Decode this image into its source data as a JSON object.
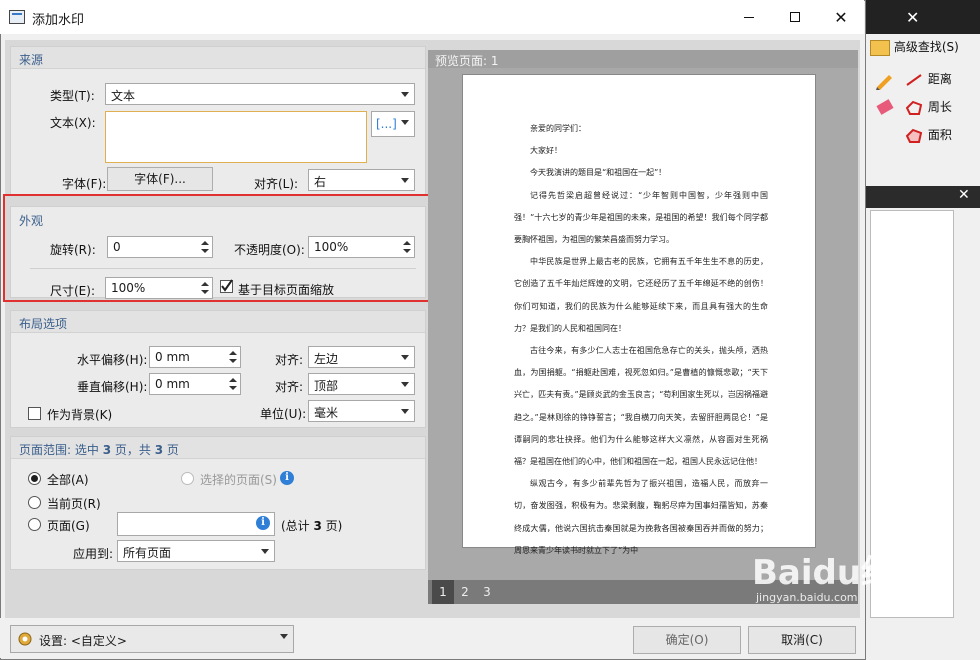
{
  "window": {
    "title": "添加水印"
  },
  "source": {
    "group_title": "来源",
    "type_label": "类型(T):",
    "type_value": "文本",
    "text_label": "文本(X):",
    "text_value": "",
    "text_menu_btn": "[...]",
    "font_label": "字体(F):",
    "font_button": "字体(F)...",
    "align_label": "对齐(L):",
    "align_value": "右"
  },
  "appearance": {
    "group_title": "外观",
    "rotation_label": "旋转(R):",
    "rotation_value": "0",
    "opacity_label": "不透明度(O):",
    "opacity_value": "100%",
    "size_label": "尺寸(E):",
    "size_value": "100%",
    "scale_checkbox_label": "基于目标页面缩放",
    "scale_checked": true
  },
  "layout": {
    "group_title": "布局选项",
    "h_offset_label": "水平偏移(H):",
    "h_offset_value": "0 mm",
    "h_align_label": "对齐:",
    "h_align_value": "左边",
    "v_offset_label": "垂直偏移(H):",
    "v_offset_value": "0 mm",
    "v_align_label": "对齐:",
    "v_align_value": "顶部",
    "background_label": "作为背景(K)",
    "background_checked": false,
    "unit_label": "单位(U):",
    "unit_value": "毫米"
  },
  "page_range": {
    "title_prefix": "页面范围: 选中 ",
    "selected_count": "3",
    "title_mid": " 页，共 ",
    "total_count": "3",
    "title_suffix": " 页",
    "all_label": "全部(A)",
    "selected_pages_label": "选择的页面(S)",
    "current_label": "当前页(R)",
    "pages_label": "页面(G)",
    "pages_value": "",
    "total_prefix": "(总计 ",
    "total_pages": "3",
    "total_suffix": " 页)",
    "apply_label": "应用到:",
    "apply_value": "所有页面"
  },
  "preview": {
    "header": "预览页面: 1",
    "pages": [
      "1",
      "2",
      "3"
    ],
    "current_page": "1",
    "doc": [
      "亲爱的同学们：",
      "大家好！",
      "今天我演讲的题目是“和祖国在一起”！",
      "记得先哲梁启超曾经说过：“少年智则中国智，少年强则中国强！”十六七岁的青少年是祖国的未来，是祖国的希望！我们每个同学都要胸怀祖国，为祖国的繁荣昌盛而努力学习。",
      "中华民族是世界上最古老的民族，它拥有五千年生生不息的历史，它创造了五千年灿烂辉煌的文明，它还经历了五千年绵延不绝的创伤！你们可知道，我们的民族为什么能够延续下来，而且具有强大的生命力？是我们的人民和祖国同在！",
      "古往今来，有多少仁人志士在祖国危急存亡的关头，抛头颅，洒热血，为国捐躯。“捐躯赴国难，视死忽如归。”是曹植的慷慨悲歌；“天下兴亡，匹夫有责。”是顾炎武的金玉良言；“苟利国家生死以，岂因祸福避趋之。”是林则徐的铮铮誓言；“我自横刀向天笑，去留肝胆两昆仑！”是谭嗣同的悲壮抉择。他们为什么能够这样大义凛然，从容面对生死祸福？是祖国在他们的心中，他们和祖国在一起，祖国人民永远记住他！",
      "纵观古今，有多少前辈先哲为了振兴祖国，造福人民，而放弃一切，奋发图强，积极有为。悲梁剩腹，鞠躬尽瘁为国事妇孺皆知，苏秦终成大儒，他说六国抗击秦国就是为挽救各国被秦国吞并而做的努力；周恩来青少年读书时就立下了“为中"
    ]
  },
  "footer": {
    "settings_label": "设置:",
    "settings_value": "<自定义>",
    "ok_button": "确定(O)",
    "cancel_button": "取消(C)"
  },
  "background_app": {
    "advanced_find": "高级查找(S)",
    "distance": "距离",
    "perimeter": "周长",
    "area": "面积"
  },
  "watermark": {
    "brand": "Baidu经验",
    "url": "jingyan.baidu.com"
  },
  "colors": {
    "group_title": "#3b5f8c",
    "highlight": "#e03030",
    "info": "#2f7fd6"
  }
}
